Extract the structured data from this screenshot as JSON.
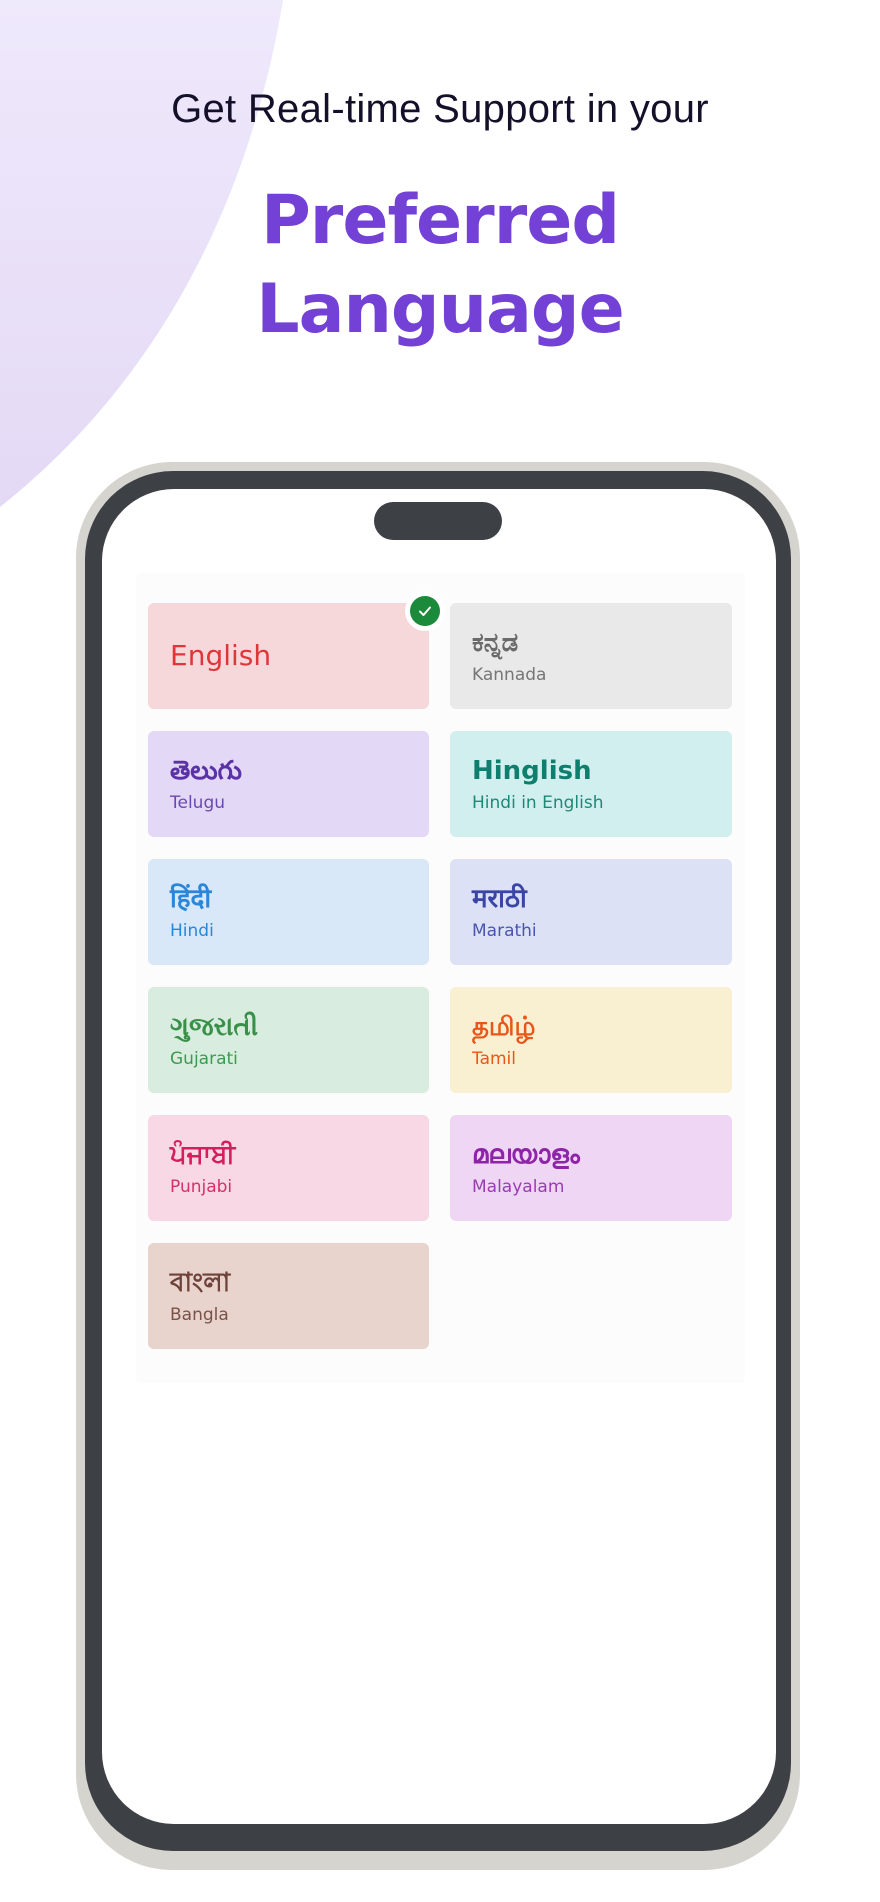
{
  "header": {
    "subtitle": "Get Real-time Support in your",
    "headline_line1": "Preferred",
    "headline_line2": "Language"
  },
  "colors": {
    "accent": "#7341d6",
    "arc_top": "#efe9fc",
    "arc_bottom": "#e4d9f5",
    "selected_check": "#1b8a3a",
    "phone_frame": "#d6d4cf",
    "phone_bezel": "#3d4045"
  },
  "language_selector": {
    "selected": "English",
    "check_icon": "check-circle-icon",
    "languages": [
      {
        "native": "English",
        "english": "",
        "bg": "#f6d8da",
        "fg": "#e0363a",
        "sub": "#e0363a",
        "selected": true
      },
      {
        "native": "ಕನ್ನಡ",
        "english": "Kannada",
        "bg": "#e9e9e9",
        "fg": "#6a6a6a",
        "sub": "#767676",
        "selected": false
      },
      {
        "native": "తెలుగు",
        "english": "Telugu",
        "bg": "#e3d8f6",
        "fg": "#5a32a8",
        "sub": "#6a48b4",
        "selected": false
      },
      {
        "native": "Hinglish",
        "english": "Hindi in English",
        "bg": "#d2efef",
        "fg": "#0e7f6e",
        "sub": "#1b8a78",
        "selected": false
      },
      {
        "native": "हिंदी",
        "english": "Hindi",
        "bg": "#d8e8f8",
        "fg": "#2a86d8",
        "sub": "#2a86d8",
        "selected": false
      },
      {
        "native": "मराठी",
        "english": "Marathi",
        "bg": "#dde1f6",
        "fg": "#3a45a6",
        "sub": "#4a55b0",
        "selected": false
      },
      {
        "native": "ગુજરાતી",
        "english": "Gujarati",
        "bg": "#d8ede0",
        "fg": "#3a9048",
        "sub": "#3f9a4e",
        "selected": false
      },
      {
        "native": "தமிழ்",
        "english": "Tamil",
        "bg": "#f8f0d0",
        "fg": "#e8561a",
        "sub": "#e8561a",
        "selected": false
      },
      {
        "native": "ਪੰਜਾਬੀ",
        "english": "Punjabi",
        "bg": "#f8d8e4",
        "fg": "#d41e5e",
        "sub": "#d4306a",
        "selected": false
      },
      {
        "native": "മലയാളം",
        "english": "Malayalam",
        "bg": "#efd6f4",
        "fg": "#8e24a8",
        "sub": "#9a3cb2",
        "selected": false
      },
      {
        "native": "বাংলা",
        "english": "Bangla",
        "bg": "#e8d4cc",
        "fg": "#6e4238",
        "sub": "#7a5248",
        "selected": false
      }
    ]
  }
}
